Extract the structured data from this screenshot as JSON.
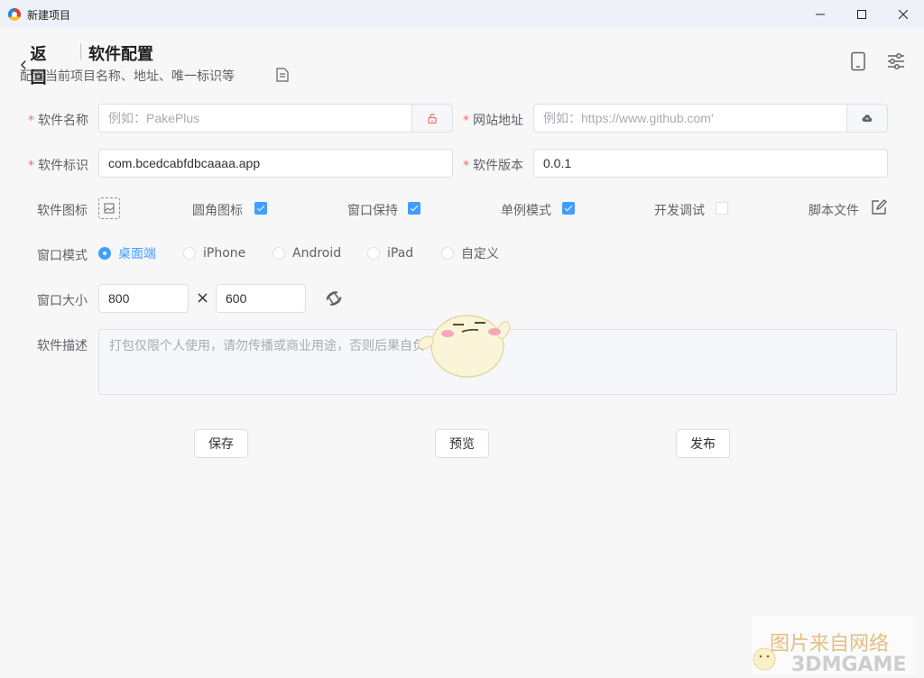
{
  "window": {
    "title": "新建项目"
  },
  "header": {
    "back_label": "返回",
    "title": "软件配置",
    "subtitle": "配置当前项目名称、地址、唯一标识等"
  },
  "form": {
    "name": {
      "label": "软件名称",
      "placeholder": "例如：PakePlus",
      "value": ""
    },
    "url": {
      "label": "网站地址",
      "placeholder": "例如：https://www.github.com'",
      "value": ""
    },
    "identifier": {
      "label": "软件标识",
      "value": "com.bcedcabfdbcaaaa.app"
    },
    "version": {
      "label": "软件版本",
      "value": "0.0.1"
    },
    "icon_label": "软件图标",
    "options": [
      {
        "label": "圆角图标",
        "checked": true
      },
      {
        "label": "窗口保持",
        "checked": true
      },
      {
        "label": "单例模式",
        "checked": true
      },
      {
        "label": "开发调试",
        "checked": false
      }
    ],
    "script_label": "脚本文件",
    "window_mode": {
      "label": "窗口模式",
      "options": [
        "桌面端",
        "iPhone",
        "Android",
        "iPad",
        "自定义"
      ],
      "selected": "桌面端"
    },
    "window_size": {
      "label": "窗口大小",
      "width": "800",
      "height": "600",
      "separator": "×"
    },
    "description": {
      "label": "软件描述",
      "placeholder": "打包仅限个人使用，请勿传播或商业用途，否则后果自负"
    }
  },
  "buttons": {
    "save": "保存",
    "preview": "预览",
    "publish": "发布"
  },
  "watermark": {
    "line1": "图片来自网络",
    "line2": "3DMGAME"
  },
  "colors": {
    "accent": "#409eff",
    "required": "#f56c6c",
    "lock": "#f56c6c"
  }
}
